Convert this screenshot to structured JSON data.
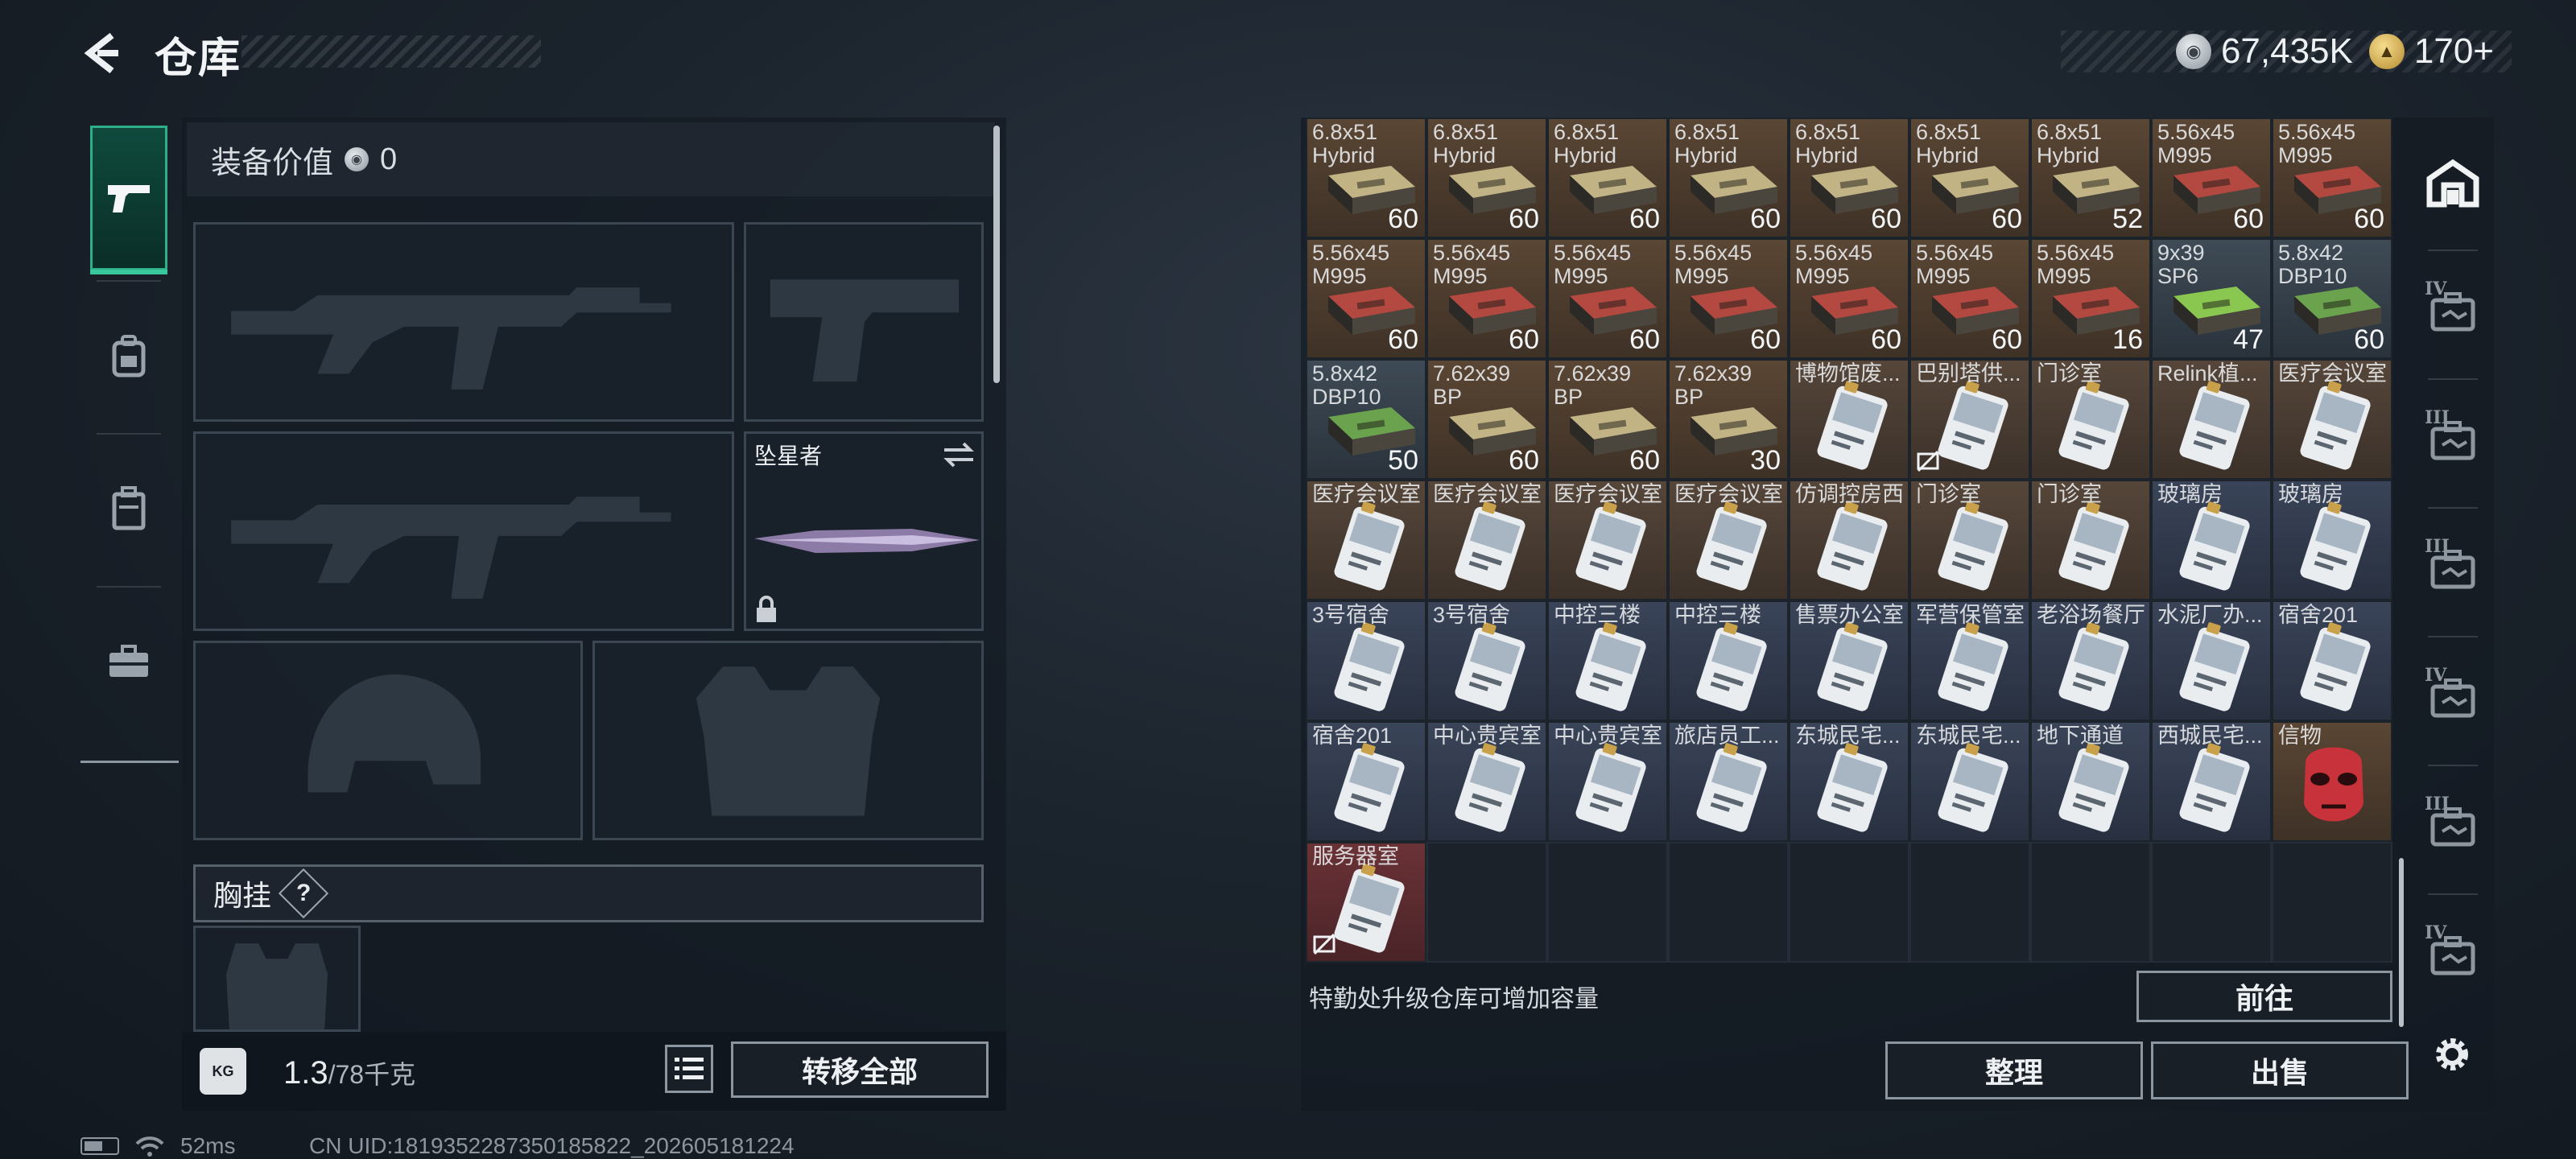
{
  "header": {
    "title": "仓库",
    "currency_silver": "67,435K",
    "currency_gold": "170+"
  },
  "left_tabs": [
    {
      "name": "tab-weapons",
      "icon": "pistol-icon",
      "active": true
    },
    {
      "name": "tab-backpack-gear",
      "icon": "backpack-icon",
      "active": false
    },
    {
      "name": "tab-storage-case",
      "icon": "case-icon",
      "active": false
    },
    {
      "name": "tab-toolbox",
      "icon": "toolbox-icon",
      "active": false
    }
  ],
  "equipment": {
    "value_label": "装备价值",
    "value": "0",
    "melee_name": "坠星者",
    "chest_rig_label": "胸挂",
    "help_symbol": "?"
  },
  "bottom_left": {
    "weight_icon_text": "KG",
    "weight_current": "1.3",
    "weight_capacity": "/78千克",
    "transfer_all": "转移全部"
  },
  "status": {
    "ping": "52ms",
    "uid": "CN UID:1819352287350185822_202605181224"
  },
  "storage": {
    "items": [
      {
        "name": "6.8x51\nHybrid",
        "count": "60",
        "kind": "ammo",
        "color": "#c8b98a"
      },
      {
        "name": "6.8x51\nHybrid",
        "count": "60",
        "kind": "ammo",
        "color": "#c8b98a"
      },
      {
        "name": "6.8x51\nHybrid",
        "count": "60",
        "kind": "ammo",
        "color": "#c8b98a"
      },
      {
        "name": "6.8x51\nHybrid",
        "count": "60",
        "kind": "ammo",
        "color": "#c8b98a"
      },
      {
        "name": "6.8x51\nHybrid",
        "count": "60",
        "kind": "ammo",
        "color": "#c8b98a"
      },
      {
        "name": "6.8x51\nHybrid",
        "count": "60",
        "kind": "ammo",
        "color": "#c8b98a"
      },
      {
        "name": "6.8x51\nHybrid",
        "count": "52",
        "kind": "ammo",
        "color": "#c8b98a"
      },
      {
        "name": "5.56x45\nM995",
        "count": "60",
        "kind": "ammo",
        "color": "#b84a42"
      },
      {
        "name": "5.56x45\nM995",
        "count": "60",
        "kind": "ammo",
        "color": "#b84a42"
      },
      {
        "name": "5.56x45\nM995",
        "count": "60",
        "kind": "ammo",
        "color": "#b84a42"
      },
      {
        "name": "5.56x45\nM995",
        "count": "60",
        "kind": "ammo",
        "color": "#b84a42"
      },
      {
        "name": "5.56x45\nM995",
        "count": "60",
        "kind": "ammo",
        "color": "#b84a42"
      },
      {
        "name": "5.56x45\nM995",
        "count": "60",
        "kind": "ammo",
        "color": "#b84a42"
      },
      {
        "name": "5.56x45\nM995",
        "count": "60",
        "kind": "ammo",
        "color": "#b84a42"
      },
      {
        "name": "5.56x45\nM995",
        "count": "60",
        "kind": "ammo",
        "color": "#b84a42"
      },
      {
        "name": "5.56x45\nM995",
        "count": "16",
        "kind": "ammo",
        "color": "#b84a42"
      },
      {
        "name": "9x39\nSP6",
        "count": "47",
        "kind": "ammo-lime",
        "color": "#8fcf52"
      },
      {
        "name": "5.8x42\nDBP10",
        "count": "60",
        "kind": "ammo-lime",
        "color": "#6fa84e"
      },
      {
        "name": "5.8x42\nDBP10",
        "count": "50",
        "kind": "ammo-lime",
        "color": "#6fa84e"
      },
      {
        "name": "7.62x39\nBP",
        "count": "60",
        "kind": "ammo",
        "color": "#c8b98a"
      },
      {
        "name": "7.62x39\nBP",
        "count": "60",
        "kind": "ammo",
        "color": "#c8b98a"
      },
      {
        "name": "7.62x39\nBP",
        "count": "30",
        "kind": "ammo",
        "color": "#c8b98a"
      },
      {
        "name": "博物馆废...",
        "count": "",
        "kind": "key",
        "color": "#d8dde2"
      },
      {
        "name": "巴别塔供...",
        "count": "",
        "kind": "key",
        "color": "#d8dde2",
        "flag": true
      },
      {
        "name": "门诊室",
        "count": "",
        "kind": "key",
        "color": "#d8dde2"
      },
      {
        "name": "Relink植...",
        "count": "",
        "kind": "key",
        "color": "#d8dde2"
      },
      {
        "name": "医疗会议室",
        "count": "",
        "kind": "key",
        "color": "#d8dde2"
      },
      {
        "name": "医疗会议室",
        "count": "",
        "kind": "key",
        "color": "#d8dde2"
      },
      {
        "name": "医疗会议室",
        "count": "",
        "kind": "key",
        "color": "#d8dde2"
      },
      {
        "name": "医疗会议室",
        "count": "",
        "kind": "key",
        "color": "#d8dde2"
      },
      {
        "name": "医疗会议室",
        "count": "",
        "kind": "key",
        "color": "#d8dde2"
      },
      {
        "name": "仿调控房西",
        "count": "",
        "kind": "key",
        "color": "#d8dde2"
      },
      {
        "name": "门诊室",
        "count": "",
        "kind": "key",
        "color": "#d8dde2"
      },
      {
        "name": "门诊室",
        "count": "",
        "kind": "key",
        "color": "#d8dde2"
      },
      {
        "name": "玻璃房",
        "count": "",
        "kind": "key-blue",
        "color": "#d8dde2"
      },
      {
        "name": "玻璃房",
        "count": "",
        "kind": "key-blue",
        "color": "#d8dde2"
      },
      {
        "name": "3号宿舍",
        "count": "",
        "kind": "key-blue",
        "color": "#d8dde2"
      },
      {
        "name": "3号宿舍",
        "count": "",
        "kind": "key-blue",
        "color": "#d8dde2"
      },
      {
        "name": "中控三楼",
        "count": "",
        "kind": "key-blue",
        "color": "#d8dde2"
      },
      {
        "name": "中控三楼",
        "count": "",
        "kind": "key-blue",
        "color": "#d8dde2"
      },
      {
        "name": "售票办公室",
        "count": "",
        "kind": "key-blue",
        "color": "#d8dde2"
      },
      {
        "name": "军营保管室",
        "count": "",
        "kind": "key-blue",
        "color": "#d8dde2"
      },
      {
        "name": "老浴场餐厅",
        "count": "",
        "kind": "key-blue",
        "color": "#d8dde2"
      },
      {
        "name": "水泥厂办...",
        "count": "",
        "kind": "key-blue",
        "color": "#d8dde2"
      },
      {
        "name": "宿舍201",
        "count": "",
        "kind": "key-blue",
        "color": "#d8dde2"
      },
      {
        "name": "宿舍201",
        "count": "",
        "kind": "key-blue",
        "color": "#d8dde2"
      },
      {
        "name": "中心贵宾室",
        "count": "",
        "kind": "key-blue",
        "color": "#d8dde2"
      },
      {
        "name": "中心贵宾室",
        "count": "",
        "kind": "key-blue",
        "color": "#d8dde2"
      },
      {
        "name": "旅店员工...",
        "count": "",
        "kind": "key-blue",
        "color": "#d8dde2"
      },
      {
        "name": "东城民宅...",
        "count": "",
        "kind": "key-blue",
        "color": "#d8dde2"
      },
      {
        "name": "东城民宅...",
        "count": "",
        "kind": "key-blue",
        "color": "#d8dde2"
      },
      {
        "name": "地下通道",
        "count": "",
        "kind": "key-blue",
        "color": "#d8dde2"
      },
      {
        "name": "西城民宅...",
        "count": "",
        "kind": "key-blue",
        "color": "#d8dde2"
      },
      {
        "name": "信物",
        "count": "",
        "kind": "relic",
        "color": "#c8323a"
      },
      {
        "name": "服务器室",
        "count": "",
        "kind": "key-red",
        "color": "#d8dde2",
        "flag": true
      }
    ],
    "hint": "特勤处升级仓库可增加容量",
    "goto": "前往",
    "sort": "整理",
    "sell": "出售"
  },
  "right_tabs": [
    {
      "name": "tab-all-storage",
      "level": "",
      "icon": "storage-all-icon"
    },
    {
      "name": "tab-case-iv-1",
      "level": "IV",
      "icon": "case-icon"
    },
    {
      "name": "tab-case-iii-1",
      "level": "III",
      "icon": "case-icon"
    },
    {
      "name": "tab-case-iii-2",
      "level": "III",
      "icon": "case-icon"
    },
    {
      "name": "tab-case-iv-2",
      "level": "IV",
      "icon": "case-icon"
    },
    {
      "name": "tab-case-iii-3",
      "level": "III",
      "icon": "case-icon"
    },
    {
      "name": "tab-case-iv-3",
      "level": "IV",
      "icon": "case-icon"
    }
  ]
}
